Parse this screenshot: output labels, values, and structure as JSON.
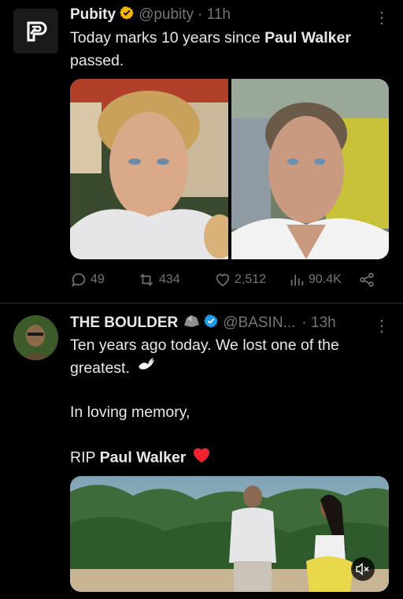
{
  "tweets": [
    {
      "name": "Pubity",
      "handle": "@pubity",
      "time": "· 11h",
      "text_before": "Today marks 10 years since ",
      "text_bold": "Paul Walker",
      "text_after": " passed.",
      "media_count": 2,
      "stats": {
        "replies": "49",
        "reposts": "434",
        "likes": "2,512",
        "views": "90.4K"
      },
      "colors": {
        "verified": "#f4b400"
      }
    },
    {
      "name": "THE BOULDER",
      "name_emoji": "rock-icon",
      "handle": "@BASIN...",
      "time": "· 13h",
      "line1": "Ten years ago today. We lost one of the greatest.",
      "line1_emoji": "dove-icon",
      "line2": "In loving memory,",
      "line3_prefix": "RIP ",
      "line3_bold": "Paul Walker",
      "line3_emoji": "red-heart-icon",
      "media": "video",
      "colors": {
        "verified": "#1d9bf0"
      }
    }
  ]
}
